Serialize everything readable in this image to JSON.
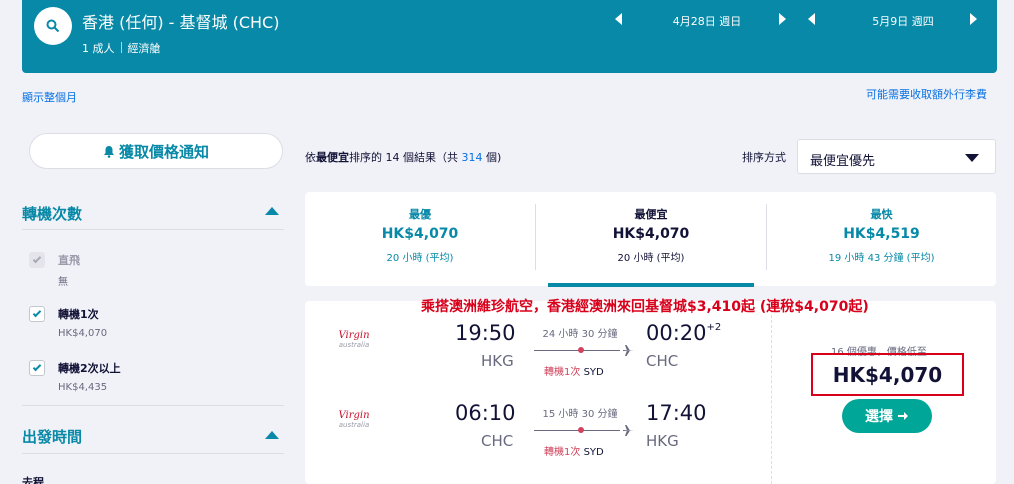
{
  "search": {
    "route": "香港 (任何) - 基督城 (CHC)",
    "passengers": "1 成人",
    "cabin": "經濟艙",
    "depart_date": "4月28日 週日",
    "return_date": "5月9日 週四"
  },
  "links": {
    "show_month": "顯示整個月",
    "baggage_fees": "可能需要收取額外行李費"
  },
  "price_alert": {
    "label": "獲取價格通知"
  },
  "filters": {
    "stops_title": "轉機次數",
    "options": [
      {
        "label": "直飛",
        "sub": "無",
        "checked": true,
        "disabled": true
      },
      {
        "label": "轉機1次",
        "sub": "HK$4,070",
        "checked": true,
        "disabled": false
      },
      {
        "label": "轉機2次以上",
        "sub": "HK$4,435",
        "checked": true,
        "disabled": false
      }
    ],
    "departure_title": "出發時間",
    "outbound_label": "去程"
  },
  "results": {
    "prefix": "依",
    "sort_word": "最便宜",
    "middle": "排序的 14 個結果（共 ",
    "total": "314",
    "suffix": " 個)",
    "sort_label": "排序方式",
    "sort_value": "最便宜優先"
  },
  "tabs": [
    {
      "title": "最優",
      "price": "HK$4,070",
      "duration": "20 小時 (平均)"
    },
    {
      "title": "最便宜",
      "price": "HK$4,070",
      "duration": "20 小時 (平均)"
    },
    {
      "title": "最快",
      "price": "HK$4,519",
      "duration": "19 小時 43 分鐘 (平均)"
    }
  ],
  "banner": "乘搭澳洲維珍航空，香港經澳洲來回基督城$3,410起 (連稅$4,070起)",
  "itinerary": {
    "airline_logo": {
      "mark": "Virgin",
      "sub": "australia"
    },
    "outbound": {
      "dep_time": "19:50",
      "dep_code": "HKG",
      "duration": "24 小時 30 分鐘",
      "arr_time": "00:20",
      "arr_offset": "+2",
      "arr_code": "CHC",
      "stops": "轉機1次",
      "via": "SYD"
    },
    "inbound": {
      "dep_time": "06:10",
      "dep_code": "CHC",
      "duration": "15 小時 30 分鐘",
      "arr_time": "17:40",
      "arr_code": "HKG",
      "stops": "轉機1次",
      "via": "SYD"
    },
    "deals": "16 個優惠，價格低至",
    "price": "HK$4,070",
    "select_label": "選擇"
  },
  "icons": {
    "search": "search-icon",
    "bell": "bell-icon",
    "plane": "plane-icon",
    "arrow_right": "arrow-right-icon"
  },
  "colors": {
    "brand": "#0789a7",
    "select_button": "#00a698",
    "highlight_red": "#d8001b",
    "stops_red": "#d1435b"
  }
}
